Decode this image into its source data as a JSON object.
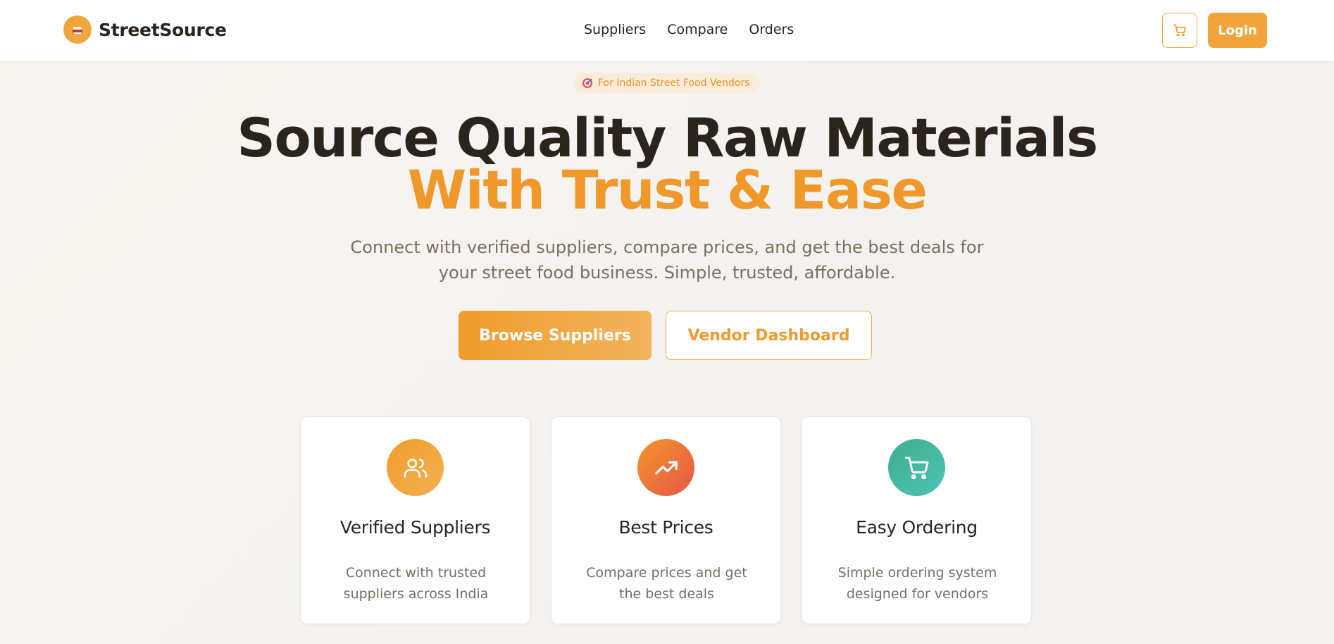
{
  "header": {
    "brand_name": "StreetSource",
    "brand_logo_icon": "food-stall-icon",
    "nav": [
      {
        "label": "Suppliers"
      },
      {
        "label": "Compare"
      },
      {
        "label": "Orders"
      }
    ],
    "cart_icon": "cart-icon",
    "login_label": "Login"
  },
  "hero": {
    "tag_icon": "target-icon",
    "tag_text": "For Indian Street Food Vendors",
    "title_line1": "Source Quality Raw Materials",
    "title_line2": "With Trust & Ease",
    "lead": "Connect with verified suppliers, compare prices, and get the best deals for your street food business. Simple, trusted, affordable.",
    "primary_button": "Browse Suppliers",
    "secondary_button": "Vendor Dashboard"
  },
  "features": [
    {
      "icon": "users-icon",
      "title": "Verified Suppliers",
      "description": "Connect with trusted suppliers across India",
      "color_from": "#f29c2b",
      "color_to": "#f2b152"
    },
    {
      "icon": "trending-up-icon",
      "title": "Best Prices",
      "description": "Compare prices and get the best deals",
      "color_from": "#f2952a",
      "color_to": "#e8564a"
    },
    {
      "icon": "cart-icon",
      "title": "Easy Ordering",
      "description": "Simple ordering system designed for vendors",
      "color_from": "#3fae8a",
      "color_to": "#4cc4b8"
    }
  ],
  "colors": {
    "accent": "#f0982a",
    "text_dark": "#2b241d",
    "text_muted": "#7b6d60"
  }
}
